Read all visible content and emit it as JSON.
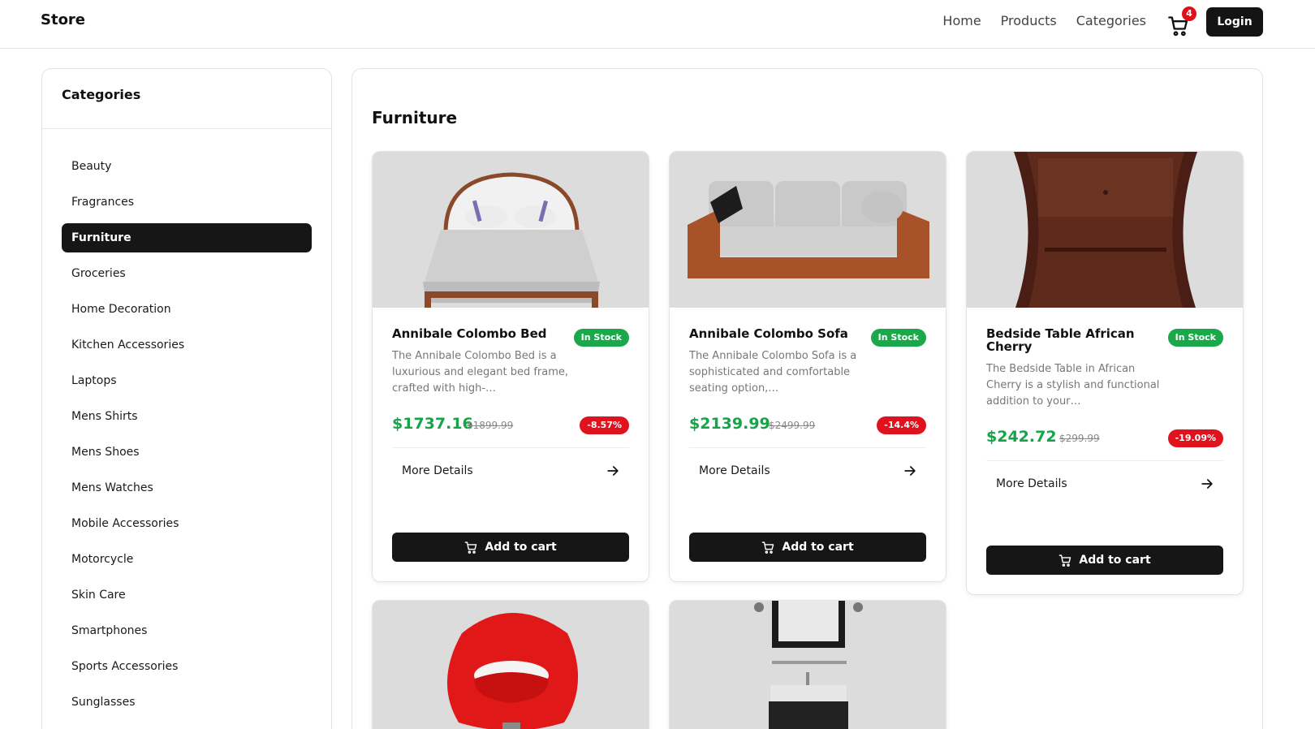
{
  "navbar": {
    "brand": "Store",
    "links": [
      "Home",
      "Products",
      "Categories"
    ],
    "cart_count": "4",
    "login_label": "Login"
  },
  "sidebar": {
    "title": "Categories",
    "items": [
      "Beauty",
      "Fragrances",
      "Furniture",
      "Groceries",
      "Home Decoration",
      "Kitchen Accessories",
      "Laptops",
      "Mens Shirts",
      "Mens Shoes",
      "Mens Watches",
      "Mobile Accessories",
      "Motorcycle",
      "Skin Care",
      "Smartphones",
      "Sports Accessories",
      "Sunglasses"
    ],
    "active": "Furniture"
  },
  "main": {
    "title": "Furniture",
    "products": [
      {
        "title": "Annibale Colombo Bed",
        "stock": "In Stock",
        "desc": "The Annibale Colombo Bed is a luxurious and elegant bed frame, crafted with high-…",
        "price": "$1737.16",
        "old_price": "$1899.99",
        "discount": "-8.57%",
        "more": "More Details",
        "add": "Add to cart"
      },
      {
        "title": "Annibale Colombo Sofa",
        "stock": "In Stock",
        "desc": "The Annibale Colombo Sofa is a sophisticated and comfortable seating option,…",
        "price": "$2139.99",
        "old_price": "$2499.99",
        "discount": "-14.4%",
        "more": "More Details",
        "add": "Add to cart"
      },
      {
        "title": "Bedside Table African Cherry",
        "stock": "In Stock",
        "desc": "The Bedside Table in African Cherry is a stylish and functional addition to your…",
        "price": "$242.72",
        "old_price": "$299.99",
        "discount": "-19.09%",
        "more": "More Details",
        "add": "Add to cart"
      }
    ]
  },
  "colors": {
    "accent": "#161616",
    "price": "#17a34a",
    "stock": "#1aa84a",
    "discount": "#e0121d"
  }
}
